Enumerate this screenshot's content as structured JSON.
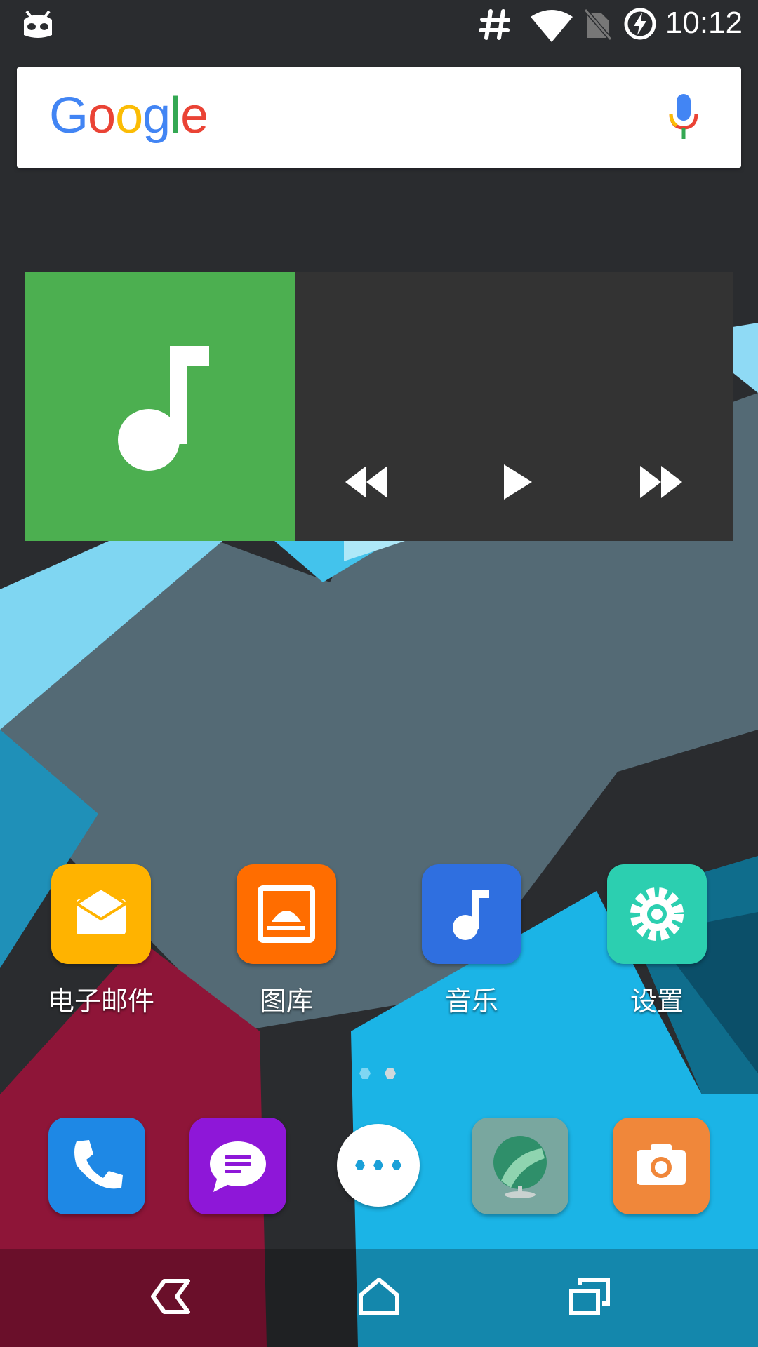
{
  "status_bar": {
    "time": "10:12",
    "icons": [
      "android-cyanogen-icon",
      "hashtag-icon",
      "wifi-icon",
      "no-sim-icon",
      "battery-charging-icon"
    ]
  },
  "search_widget": {
    "logo_letters": [
      {
        "char": "G",
        "color": "#4285F4"
      },
      {
        "char": "o",
        "color": "#EA4335"
      },
      {
        "char": "o",
        "color": "#FBBC05"
      },
      {
        "char": "g",
        "color": "#4285F4"
      },
      {
        "char": "l",
        "color": "#34A853"
      },
      {
        "char": "e",
        "color": "#EA4335"
      }
    ],
    "mic_icon": "mic-icon"
  },
  "music_widget": {
    "art_color": "#4caf50",
    "controls": [
      "rewind-icon",
      "play-icon",
      "fast-forward-icon"
    ]
  },
  "apps": [
    {
      "label": "电子邮件",
      "icon": "email-icon",
      "color": "#ffb300"
    },
    {
      "label": "图库",
      "icon": "gallery-icon",
      "color": "#ff6d00"
    },
    {
      "label": "音乐",
      "icon": "music-icon",
      "color": "#2f6fe0"
    },
    {
      "label": "设置",
      "icon": "settings-icon",
      "color": "#2ccfb0"
    }
  ],
  "dock": [
    {
      "icon": "phone-icon",
      "color": "#1e88e5"
    },
    {
      "icon": "messaging-icon",
      "color": "#8e17d8"
    },
    {
      "icon": "app-drawer-icon",
      "color": "#ffffff"
    },
    {
      "icon": "browser-icon",
      "color": "#79a79f"
    },
    {
      "icon": "camera-icon",
      "color": "#f0873a"
    }
  ],
  "page_indicator": {
    "pages": 2,
    "active": 0
  },
  "nav_bar": [
    "back-icon",
    "home-icon",
    "recents-icon"
  ]
}
